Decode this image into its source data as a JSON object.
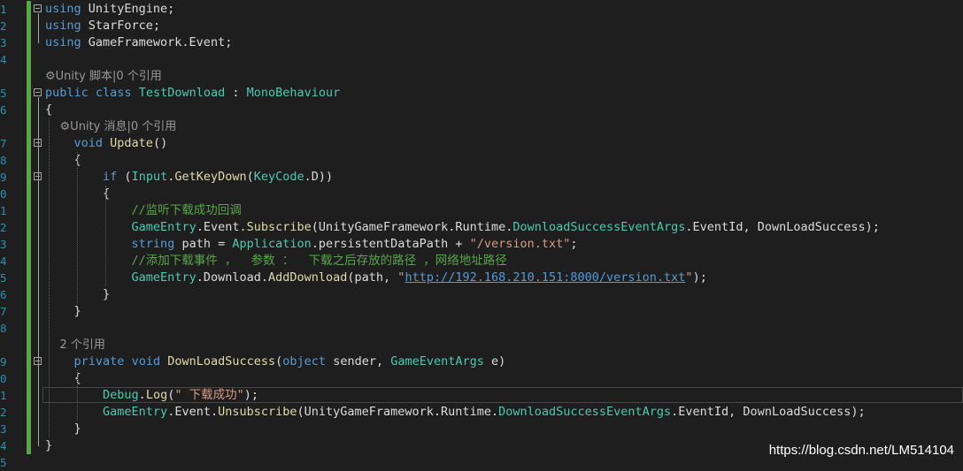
{
  "editor": {
    "line_numbers": [
      "1",
      "2",
      "3",
      "4",
      "",
      "5",
      "6",
      "",
      "7",
      "8",
      "9",
      "0",
      "1",
      "2",
      "3",
      "4",
      "5",
      "6",
      "7",
      "8",
      "",
      "9",
      "0",
      "1",
      "2",
      "3",
      "4",
      "5"
    ],
    "lines": [
      [
        {
          "c": "kw",
          "t": "using"
        },
        {
          "c": "",
          "t": " UnityEngine;"
        }
      ],
      [
        {
          "c": "kw",
          "t": "using"
        },
        {
          "c": "",
          "t": " StarForce;"
        }
      ],
      [
        {
          "c": "kw",
          "t": "using"
        },
        {
          "c": "",
          "t": " GameFramework.Event;"
        }
      ],
      [],
      [
        {
          "c": "lens",
          "t": "⚙Unity 脚本|0 个引用"
        }
      ],
      [
        {
          "c": "kw",
          "t": "public"
        },
        {
          "c": "",
          "t": " "
        },
        {
          "c": "kw",
          "t": "class"
        },
        {
          "c": "",
          "t": " "
        },
        {
          "c": "ty",
          "t": "TestDownload"
        },
        {
          "c": "",
          "t": " : "
        },
        {
          "c": "ty",
          "t": "MonoBehaviour"
        }
      ],
      [
        {
          "c": "",
          "t": "{"
        }
      ],
      [
        {
          "c": "lens",
          "t": "    ⚙Unity 消息|0 个引用"
        }
      ],
      [
        {
          "c": "",
          "t": "    "
        },
        {
          "c": "kw",
          "t": "void"
        },
        {
          "c": "",
          "t": " "
        },
        {
          "c": "fn",
          "t": "Update"
        },
        {
          "c": "",
          "t": "()"
        }
      ],
      [
        {
          "c": "",
          "t": "    {"
        }
      ],
      [
        {
          "c": "",
          "t": "        "
        },
        {
          "c": "kw",
          "t": "if"
        },
        {
          "c": "",
          "t": " ("
        },
        {
          "c": "ty",
          "t": "Input"
        },
        {
          "c": "",
          "t": "."
        },
        {
          "c": "fn",
          "t": "GetKeyDown"
        },
        {
          "c": "",
          "t": "("
        },
        {
          "c": "ty",
          "t": "KeyCode"
        },
        {
          "c": "",
          "t": ".D))"
        }
      ],
      [
        {
          "c": "",
          "t": "        {"
        }
      ],
      [
        {
          "c": "",
          "t": "            "
        },
        {
          "c": "cm",
          "t": "//监听下载成功回调"
        }
      ],
      [
        {
          "c": "",
          "t": "            "
        },
        {
          "c": "ty",
          "t": "GameEntry"
        },
        {
          "c": "",
          "t": ".Event."
        },
        {
          "c": "fn",
          "t": "Subscribe"
        },
        {
          "c": "",
          "t": "(UnityGameFramework.Runtime."
        },
        {
          "c": "ty",
          "t": "DownloadSuccessEventArgs"
        },
        {
          "c": "",
          "t": ".EventId, DownLoadSuccess);"
        }
      ],
      [
        {
          "c": "",
          "t": "            "
        },
        {
          "c": "kw",
          "t": "string"
        },
        {
          "c": "",
          "t": " path = "
        },
        {
          "c": "ty",
          "t": "Application"
        },
        {
          "c": "",
          "t": ".persistentDataPath + "
        },
        {
          "c": "st",
          "t": "\"/version.txt\""
        },
        {
          "c": "",
          "t": ";"
        }
      ],
      [
        {
          "c": "",
          "t": "            "
        },
        {
          "c": "cm",
          "t": "//添加下载事件 ，  参数 ：  下载之后存放的路径 ，网络地址路径"
        }
      ],
      [
        {
          "c": "",
          "t": "            "
        },
        {
          "c": "ty",
          "t": "GameEntry"
        },
        {
          "c": "",
          "t": ".Download."
        },
        {
          "c": "fn",
          "t": "AddDownload"
        },
        {
          "c": "",
          "t": "(path, "
        },
        {
          "c": "st",
          "t": "\""
        },
        {
          "c": "lnk",
          "t": "http://192.168.210.151:8000/version.txt"
        },
        {
          "c": "st",
          "t": "\""
        },
        {
          "c": "",
          "t": ");"
        }
      ],
      [
        {
          "c": "",
          "t": "        }"
        }
      ],
      [
        {
          "c": "",
          "t": "    }"
        }
      ],
      [],
      [
        {
          "c": "lens",
          "t": "    2 个引用"
        }
      ],
      [
        {
          "c": "",
          "t": "    "
        },
        {
          "c": "kw",
          "t": "private"
        },
        {
          "c": "",
          "t": " "
        },
        {
          "c": "kw",
          "t": "void"
        },
        {
          "c": "",
          "t": " "
        },
        {
          "c": "fn",
          "t": "DownLoadSuccess"
        },
        {
          "c": "",
          "t": "("
        },
        {
          "c": "kw",
          "t": "object"
        },
        {
          "c": "",
          "t": " sender, "
        },
        {
          "c": "ty",
          "t": "GameEventArgs"
        },
        {
          "c": "",
          "t": " e)"
        }
      ],
      [
        {
          "c": "",
          "t": "    {"
        }
      ],
      [
        {
          "c": "",
          "t": "        "
        },
        {
          "c": "ty",
          "t": "Debug"
        },
        {
          "c": "",
          "t": "."
        },
        {
          "c": "fn",
          "t": "Log"
        },
        {
          "c": "",
          "t": "("
        },
        {
          "c": "st",
          "t": "\" 下载成功\""
        },
        {
          "c": "",
          "t": ");"
        }
      ],
      [
        {
          "c": "",
          "t": "        "
        },
        {
          "c": "ty",
          "t": "GameEntry"
        },
        {
          "c": "",
          "t": ".Event."
        },
        {
          "c": "fn",
          "t": "Unsubscribe"
        },
        {
          "c": "",
          "t": "(UnityGameFramework.Runtime."
        },
        {
          "c": "ty",
          "t": "DownloadSuccessEventArgs"
        },
        {
          "c": "",
          "t": ".EventId, DownLoadSuccess);"
        }
      ],
      [
        {
          "c": "",
          "t": "    }"
        }
      ],
      [
        {
          "c": "",
          "t": "}"
        }
      ],
      []
    ]
  },
  "watermark": "https://blog.csdn.net/LM514104",
  "colors": {
    "background": "#1e1e1e",
    "keyword": "#569cd6",
    "type": "#4ec9b0",
    "comment": "#57a64a",
    "string": "#d69d85",
    "line_number": "#2b91af",
    "change_bar": "#57a64a"
  }
}
